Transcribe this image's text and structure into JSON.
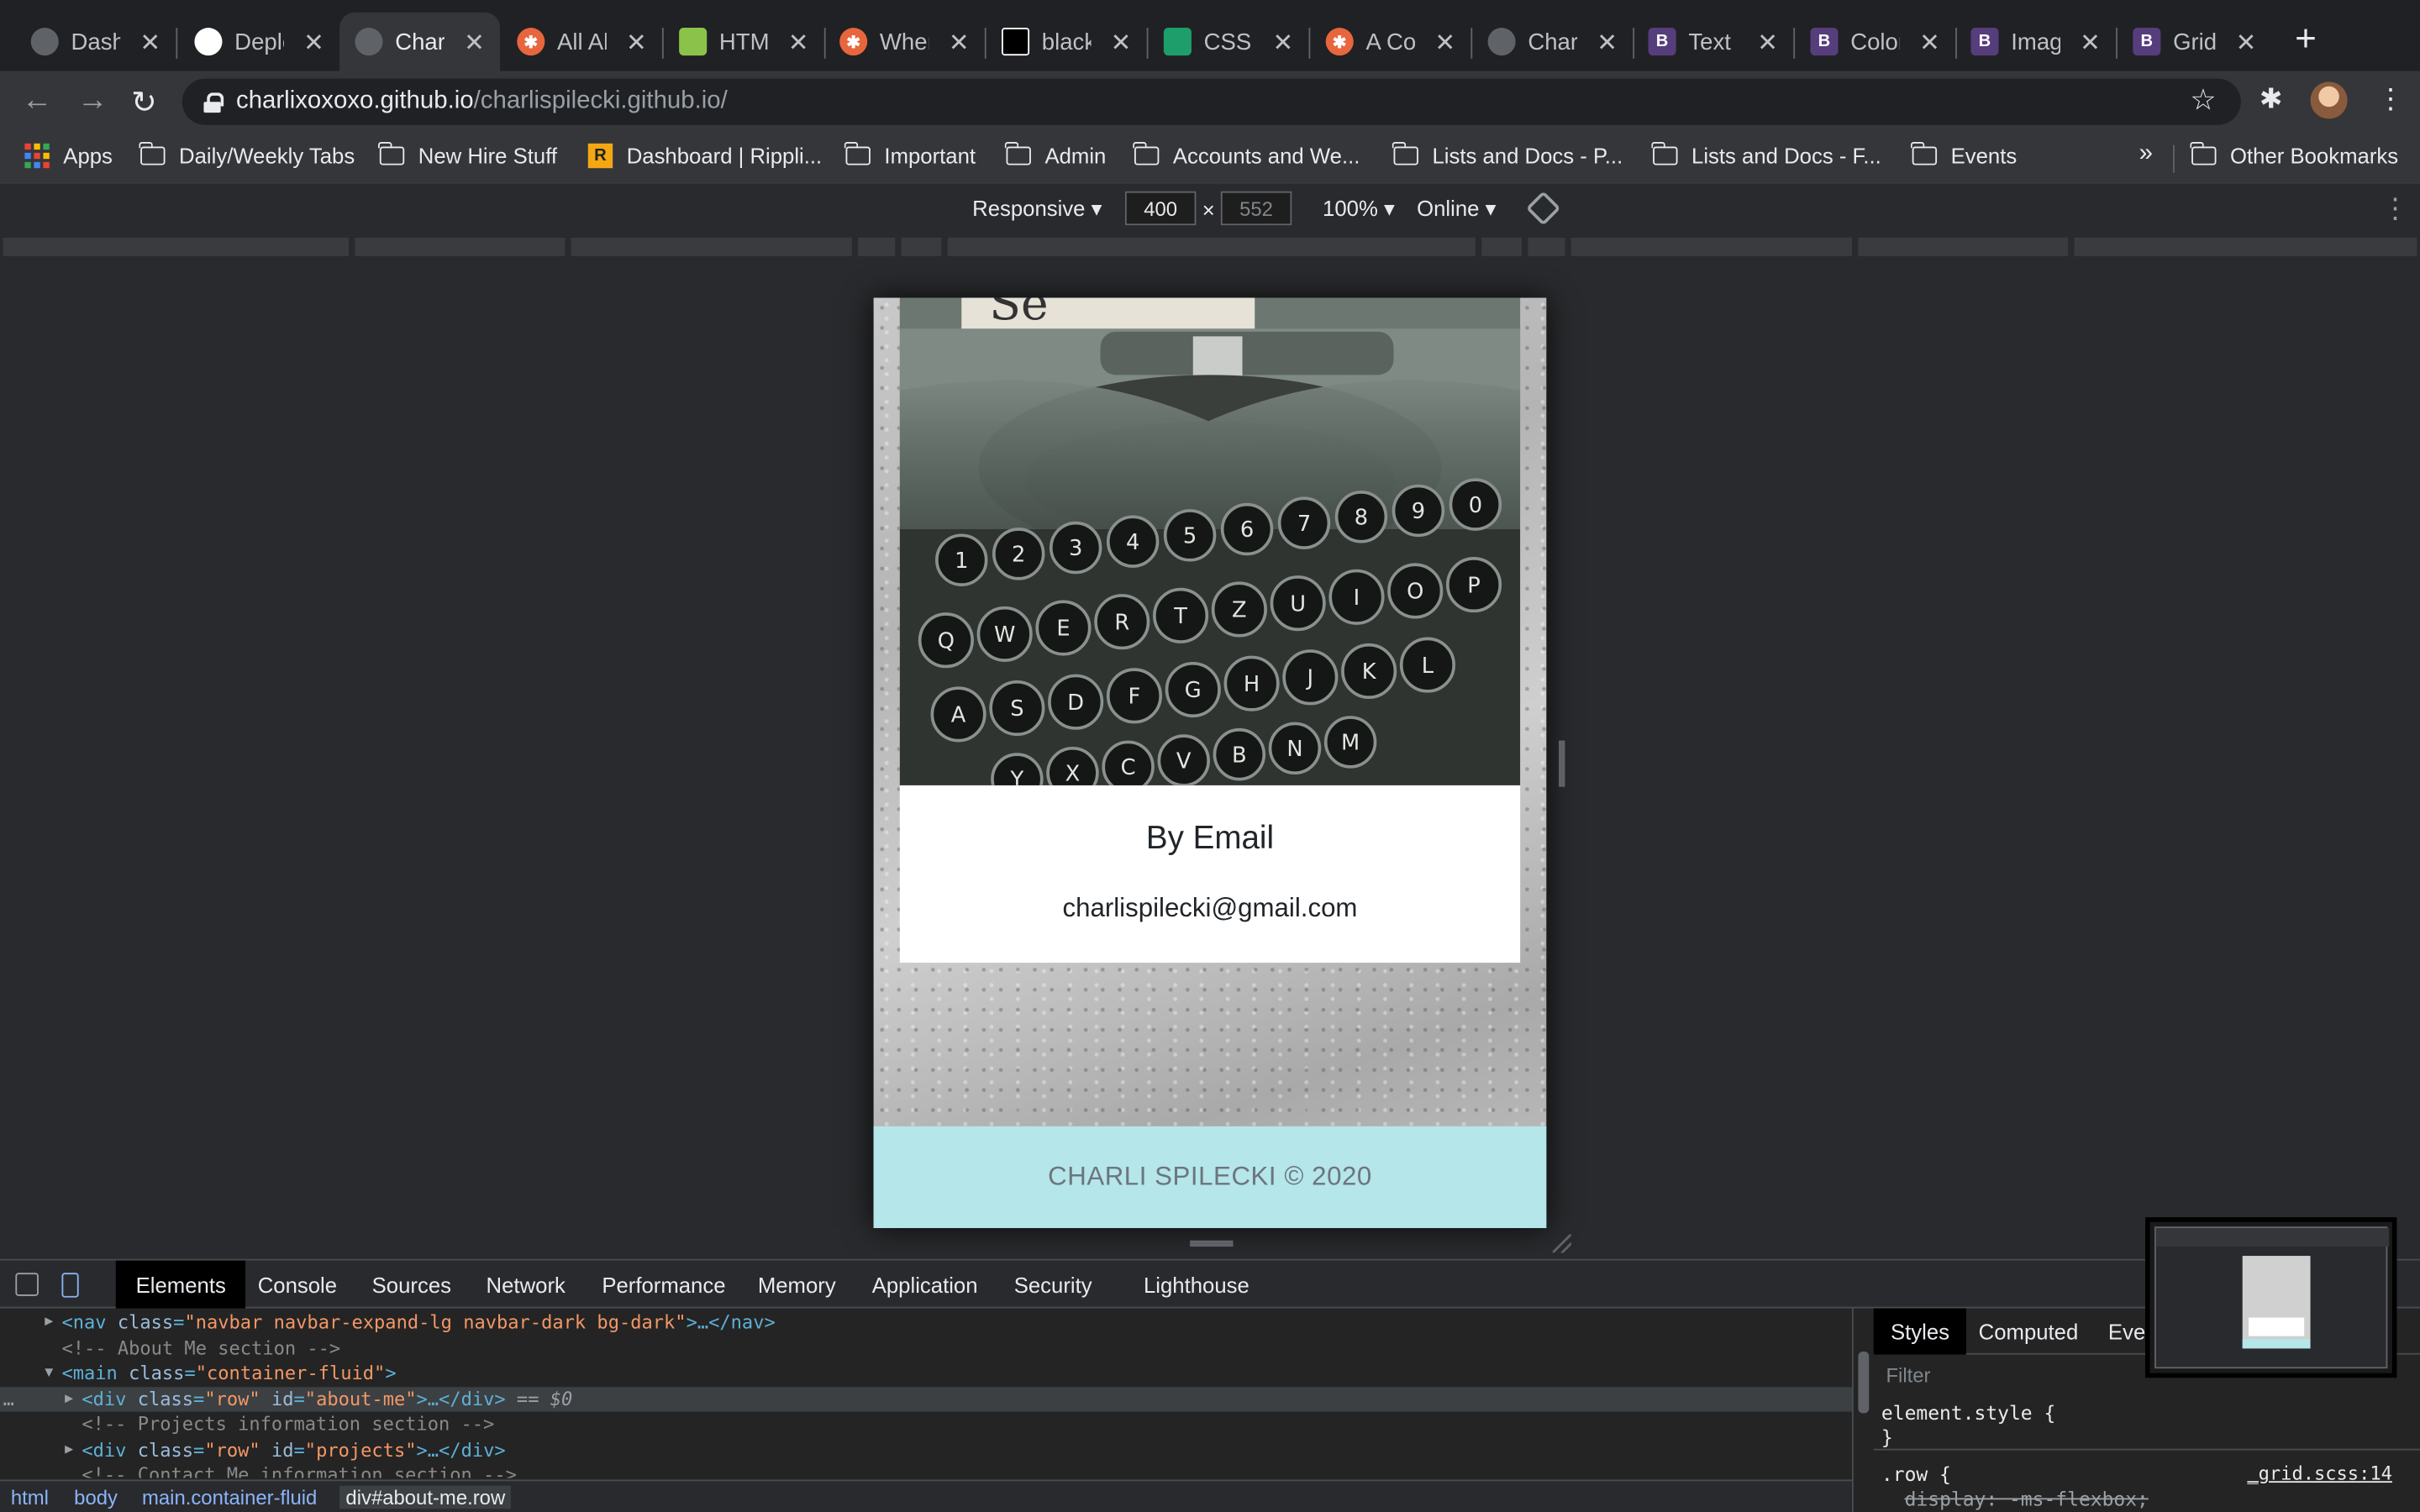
{
  "browser": {
    "tabs": [
      {
        "title": "Dashboard",
        "icon": "globe-icon",
        "color": "#5f6368"
      },
      {
        "title": "Deploy",
        "icon": "github-icon",
        "color": "#ffffff"
      },
      {
        "title": "Charli",
        "icon": "globe-icon",
        "color": "#5f6368",
        "active": true
      },
      {
        "title": "All About",
        "icon": "asterisk-icon",
        "color": "#e8663d"
      },
      {
        "title": "HTML",
        "icon": "html-icon",
        "color": "#8bc34a"
      },
      {
        "title": "When",
        "icon": "asterisk-icon",
        "color": "#e8663d"
      },
      {
        "title": "black",
        "icon": "black-square-icon",
        "color": "#000000"
      },
      {
        "title": "CSS l",
        "icon": "css-icon",
        "color": "#1e9e6a"
      },
      {
        "title": "A Com",
        "icon": "asterisk-icon",
        "color": "#e8663d"
      },
      {
        "title": "Charli",
        "icon": "globe-icon",
        "color": "#5f6368"
      },
      {
        "title": "Text ·",
        "icon": "bootstrap-icon",
        "color": "#563d7c"
      },
      {
        "title": "Color",
        "icon": "bootstrap-icon",
        "color": "#563d7c"
      },
      {
        "title": "Image",
        "icon": "bootstrap-icon",
        "color": "#563d7c"
      },
      {
        "title": "Grid s",
        "icon": "bootstrap-icon",
        "color": "#563d7c"
      }
    ],
    "url_host": "charlixoxoxo.github.io",
    "url_path": "/charlispilecki.github.io/",
    "bookmarks": {
      "apps": "Apps",
      "items": [
        "Daily/Weekly Tabs",
        "New Hire Stuff",
        "Dashboard | Rippli...",
        "Important",
        "Admin",
        "Accounts and We...",
        "Lists and Docs - P...",
        "Lists and Docs - F...",
        "Events"
      ],
      "overflow": "»",
      "other": "Other Bookmarks"
    }
  },
  "device_toolbar": {
    "mode": "Responsive",
    "width": "400",
    "times": "×",
    "height": "552",
    "zoom": "100%",
    "network": "Online"
  },
  "page": {
    "card_title": "By Email",
    "card_email": "charlispilecki@gmail.com",
    "footer": "CHARLI SPILECKI © 2020",
    "typewriter_keys": [
      "1",
      "2",
      "3",
      "4",
      "5",
      "6",
      "7",
      "8",
      "9",
      "0",
      "Q",
      "W",
      "E",
      "R",
      "T",
      "Z",
      "U",
      "I",
      "O",
      "P",
      "A",
      "S",
      "D",
      "F",
      "G",
      "H",
      "J",
      "K",
      "L",
      "Y",
      "X",
      "C",
      "V",
      "B",
      "N",
      "M"
    ]
  },
  "devtools": {
    "tabs": [
      "Elements",
      "Console",
      "Sources",
      "Network",
      "Performance",
      "Memory",
      "Application",
      "Security",
      "Lighthouse"
    ],
    "selected_tab": "Elements",
    "code_lines": [
      {
        "pre": "",
        "tag_open": "<nav ",
        "attr": "class",
        "val": "\"navbar navbar-expand-lg navbar-dark bg-dark\"",
        "tag_close": ">…</nav>",
        "triangle": "▶"
      },
      {
        "comment": "<!-- About Me section -->"
      },
      {
        "pre": "",
        "tag_open": "<main ",
        "attr": "class",
        "val": "\"container-fluid\"",
        "tag_close": ">",
        "triangle": "▼"
      },
      {
        "pre": "",
        "tag_open": "<div ",
        "attr": "class",
        "val": "\"row\"",
        "attr2": "id",
        "val2": "\"about-me\"",
        "tag_close": ">…</div>",
        "suffix": " == $0",
        "triangle": "▶",
        "highlight": true
      },
      {
        "comment": "<!-- Projects information section -->"
      },
      {
        "pre": "",
        "tag_open": "<div ",
        "attr": "class",
        "val": "\"row\"",
        "attr2": "id",
        "val2": "\"projects\"",
        "tag_close": ">…</div>",
        "triangle": "▶"
      },
      {
        "comment": "<!-- Contact Me information section -->"
      }
    ],
    "breadcrumbs": [
      "html",
      "body",
      "main.container-fluid",
      "div#about-me.row"
    ],
    "styles_tabs": [
      "Styles",
      "Computed",
      "Event"
    ],
    "filter_placeholder": "Filter",
    "element_style": "element.style {",
    "close_brace": "}",
    "row_rule": ".row {",
    "row_decl": "display: -ms-flexbox;",
    "source_link": "_grid.scss:14"
  }
}
